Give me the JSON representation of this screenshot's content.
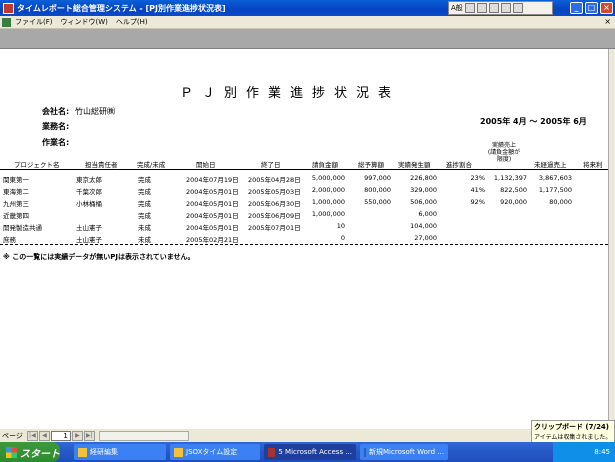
{
  "window": {
    "title": "タイムレポート総合管理システム - [PJ別作業進捗状況表]",
    "ime_mode": "A般"
  },
  "menu": [
    "ファイル(F)",
    "ウィンドウ(W)",
    "ヘルプ(H)"
  ],
  "report": {
    "title": "ＰＪ別作業進捗状況表",
    "company_label": "会社名:",
    "company_value": "竹山総研㈱",
    "work_label": "業務名:",
    "worker_label": "作業名:",
    "period": "2005年  4月 〜 2005年  6月",
    "columns": [
      "プロジェクト名",
      "担当責任者",
      "完成/未成",
      "開始日",
      "終了日",
      "請負金額",
      "総予算額",
      "実績発生額",
      "進捗割合",
      "実績売上\n(請負金額が\n限度)",
      "未経過売上",
      "将来利"
    ],
    "rows": [
      {
        "project": "関東第一",
        "manager": "東京太郎",
        "status": "完成",
        "start": "2004年07月19日",
        "end": "2005年04月28日",
        "contract": "5,000,000",
        "budget": "997,000",
        "actual": "226,800",
        "progress": "23%",
        "sales": "1,132,397",
        "unearned": "3,867,603"
      },
      {
        "project": "東海第二",
        "manager": "千葉次郎",
        "status": "完成",
        "start": "2004年05月01日",
        "end": "2005年05月03日",
        "contract": "2,000,000",
        "budget": "800,000",
        "actual": "329,000",
        "progress": "41%",
        "sales": "822,500",
        "unearned": "1,177,500"
      },
      {
        "project": "九州第三",
        "manager": "小林桶桶",
        "status": "完成",
        "start": "2004年05月01日",
        "end": "2005年06月30日",
        "contract": "1,000,000",
        "budget": "550,000",
        "actual": "506,000",
        "progress": "92%",
        "sales": "920,000",
        "unearned": "80,000"
      },
      {
        "project": "近畿第四",
        "manager": "",
        "status": "完成",
        "start": "2004年05月01日",
        "end": "2005年06月09日",
        "contract": "1,000,000",
        "budget": "",
        "actual": "6,000",
        "progress": "",
        "sales": "",
        "unearned": ""
      },
      {
        "project": "開発製造共通",
        "manager": "土山憲子",
        "status": "未成",
        "start": "2004年05月01日",
        "end": "2005年07月01日",
        "contract": "10",
        "budget": "",
        "actual": "104,000",
        "progress": "",
        "sales": "",
        "unearned": ""
      },
      {
        "project": "庶務",
        "manager": "土山憲子",
        "status": "未成",
        "start": "2005年02月21日",
        "end": "",
        "contract": "0",
        "budget": "",
        "actual": "27,000",
        "progress": "",
        "sales": "",
        "unearned": ""
      }
    ],
    "note": "※ この一覧には実績データが無いPJは表示されていません。"
  },
  "nav": {
    "label": "ページ",
    "page": "1"
  },
  "clipboard": {
    "title": "クリップボード (7/24)",
    "subtitle": "アイテムは収集されました。"
  },
  "taskbar": {
    "start": "スタート",
    "tasks": [
      "経研編集",
      "JSOXタイム設定",
      "5 Microsoft Access ...",
      "新規Microsoft Word ..."
    ],
    "clock": "8:45"
  }
}
